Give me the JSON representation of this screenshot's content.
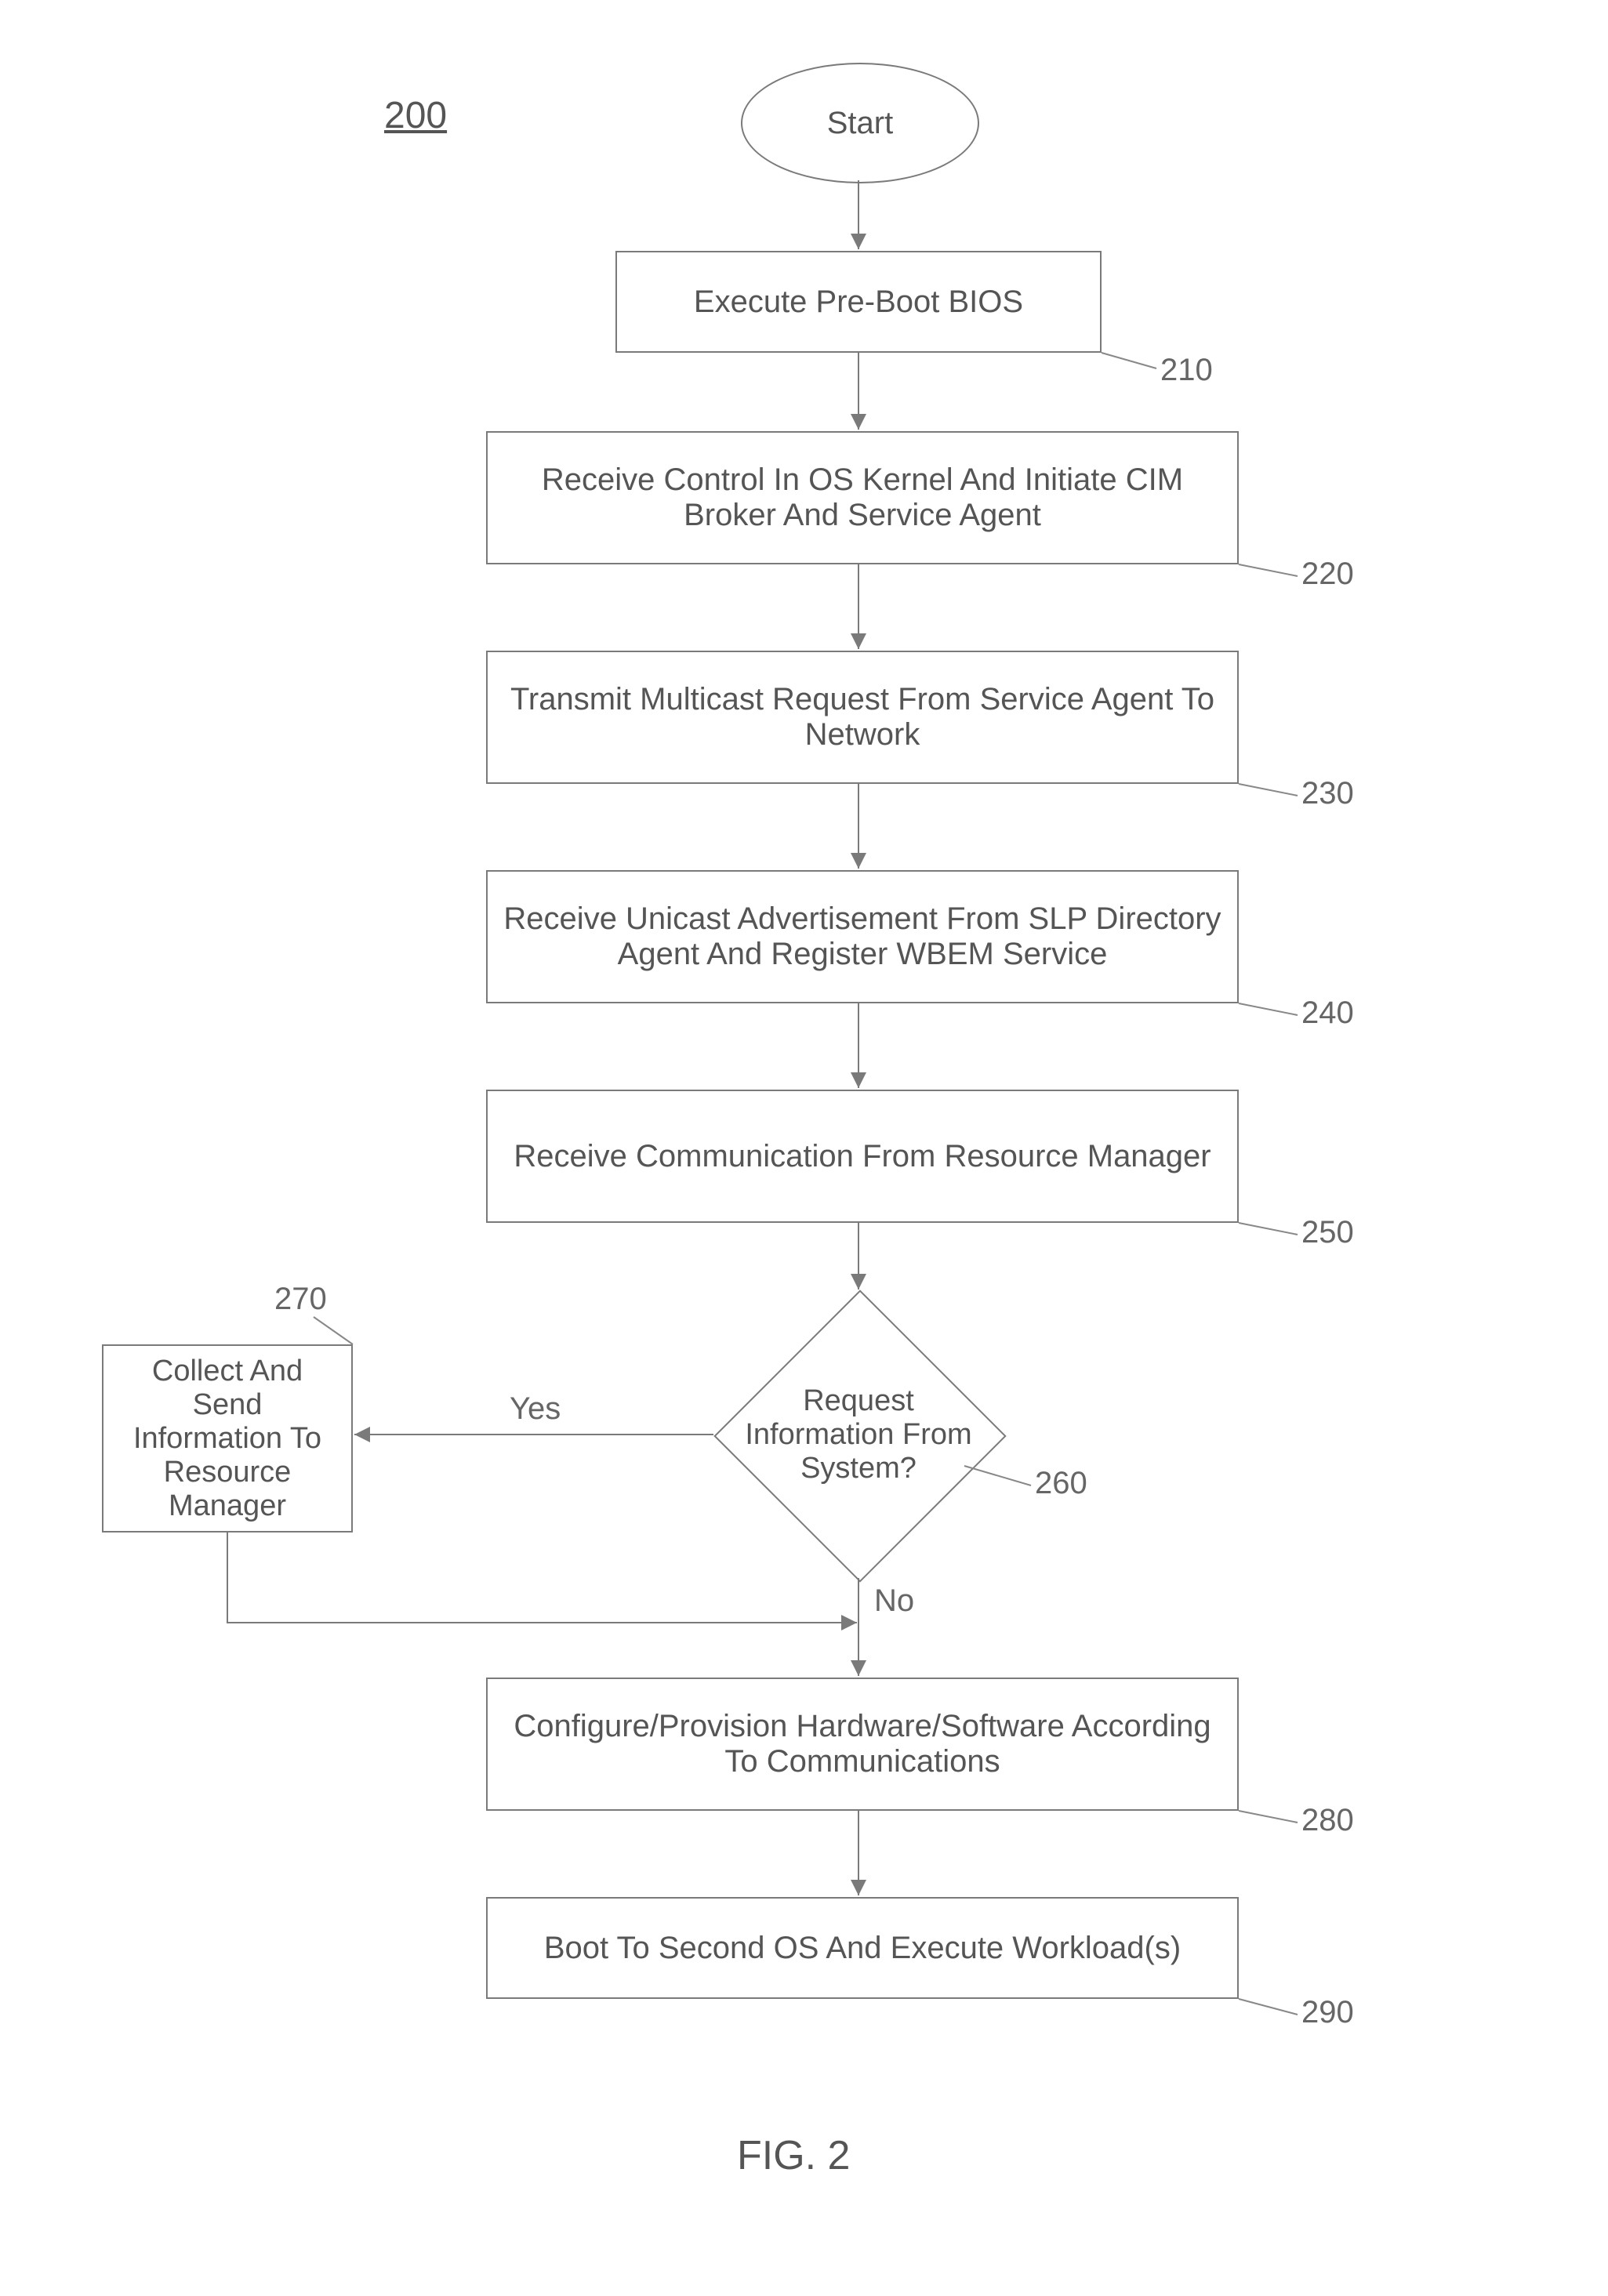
{
  "figure_number": "200",
  "figure_caption": "FIG. 2",
  "nodes": {
    "start": "Start",
    "n210": {
      "label": "210",
      "text": "Execute Pre-Boot BIOS"
    },
    "n220": {
      "label": "220",
      "text": "Receive Control In OS Kernel And Initiate CIM Broker And Service Agent"
    },
    "n230": {
      "label": "230",
      "text": "Transmit Multicast Request From Service Agent To Network"
    },
    "n240": {
      "label": "240",
      "text": "Receive Unicast Advertisement From SLP Directory Agent And Register WBEM Service"
    },
    "n250": {
      "label": "250",
      "text": "Receive Communication From Resource Manager"
    },
    "n260": {
      "label": "260",
      "text": "Request Information From System?"
    },
    "n270": {
      "label": "270",
      "text": "Collect And Send Information To Resource Manager"
    },
    "n280": {
      "label": "280",
      "text": "Configure/Provision Hardware/Software According To Communications"
    },
    "n290": {
      "label": "290",
      "text": "Boot To Second OS And Execute Workload(s)"
    }
  },
  "edges": {
    "yes": "Yes",
    "no": "No"
  }
}
